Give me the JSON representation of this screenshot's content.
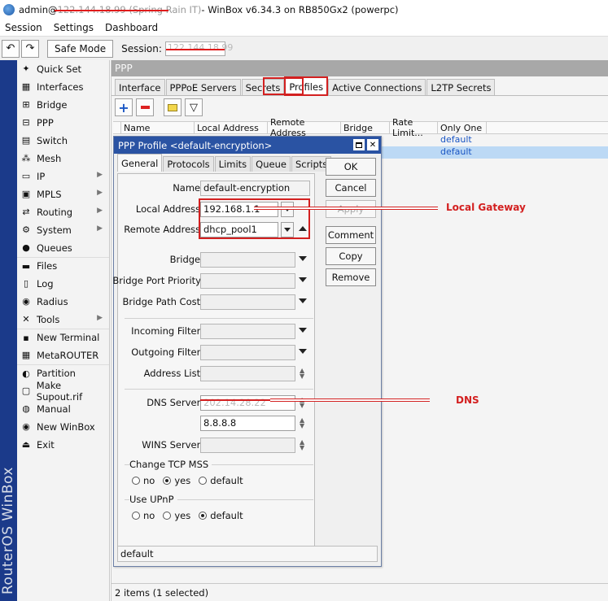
{
  "window": {
    "title": "admin@",
    "title_redacted": "122.144.18.99 (Spring Rain IT)",
    "title_rest": " - WinBox v6.34.3 on RB850Gx2 (powerpc)"
  },
  "menubar": [
    "Session",
    "Settings",
    "Dashboard"
  ],
  "toolbar": {
    "undo": "↶",
    "redo": "↷",
    "safe_mode": "Safe Mode",
    "session_label": "Session:",
    "session_value": "122.144.18.99"
  },
  "brand": "RouterOS WinBox",
  "sidebar": {
    "items": [
      {
        "label": "Quick Set",
        "icon": "quick-set-icon",
        "glyph": "✦",
        "submenu": false
      },
      {
        "label": "Interfaces",
        "icon": "interfaces-icon",
        "glyph": "▦",
        "submenu": false
      },
      {
        "label": "Bridge",
        "icon": "bridge-icon",
        "glyph": "⊞",
        "submenu": false
      },
      {
        "label": "PPP",
        "icon": "ppp-icon",
        "glyph": "⊟",
        "submenu": false
      },
      {
        "label": "Switch",
        "icon": "switch-icon",
        "glyph": "▤",
        "submenu": false
      },
      {
        "label": "Mesh",
        "icon": "mesh-icon",
        "glyph": "⁂",
        "submenu": false
      },
      {
        "label": "IP",
        "icon": "ip-icon",
        "glyph": "▭",
        "submenu": true
      },
      {
        "label": "MPLS",
        "icon": "mpls-icon",
        "glyph": "▣",
        "submenu": true
      },
      {
        "label": "Routing",
        "icon": "routing-icon",
        "glyph": "⇄",
        "submenu": true
      },
      {
        "label": "System",
        "icon": "system-icon",
        "glyph": "⚙",
        "submenu": true
      },
      {
        "label": "Queues",
        "icon": "queues-icon",
        "glyph": "●",
        "submenu": false
      },
      {
        "label": "Files",
        "icon": "files-icon",
        "glyph": "▬",
        "submenu": false
      },
      {
        "label": "Log",
        "icon": "log-icon",
        "glyph": "▯",
        "submenu": false
      },
      {
        "label": "Radius",
        "icon": "radius-icon",
        "glyph": "◉",
        "submenu": false
      },
      {
        "label": "Tools",
        "icon": "tools-icon",
        "glyph": "✕",
        "submenu": true
      },
      {
        "label": "New Terminal",
        "icon": "terminal-icon",
        "glyph": "▪",
        "submenu": false
      },
      {
        "label": "MetaROUTER",
        "icon": "metarouter-icon",
        "glyph": "▦",
        "submenu": false
      },
      {
        "label": "Partition",
        "icon": "partition-icon",
        "glyph": "◐",
        "submenu": false
      },
      {
        "label": "Make Supout.rif",
        "icon": "supout-icon",
        "glyph": "▢",
        "submenu": false
      },
      {
        "label": "Manual",
        "icon": "manual-icon",
        "glyph": "◍",
        "submenu": false
      },
      {
        "label": "New WinBox",
        "icon": "winbox-icon",
        "glyph": "◉",
        "submenu": false
      },
      {
        "label": "Exit",
        "icon": "exit-icon",
        "glyph": "⏏",
        "submenu": false
      }
    ]
  },
  "ppp": {
    "title": "PPP",
    "tabs": [
      "Interface",
      "PPPoE Servers",
      "Secrets",
      "Profiles",
      "Active Connections",
      "L2TP Secrets"
    ],
    "active_tab": "Profiles",
    "columns": [
      "Name",
      "Local Address",
      "Remote Address",
      "Bridge",
      "Rate Limit...",
      "Only One"
    ],
    "rows": [
      {
        "only_one": "default",
        "selected": false
      },
      {
        "only_one": "default",
        "selected": true
      }
    ],
    "status": "2 items (1 selected)"
  },
  "dialog": {
    "title": "PPP Profile <default-encryption>",
    "tabs": [
      "General",
      "Protocols",
      "Limits",
      "Queue",
      "Scripts"
    ],
    "fields": {
      "name_label": "Name:",
      "name_value": "default-encryption",
      "local_label": "Local Address:",
      "local_value": "192.168.1.1",
      "remote_label": "Remote Address:",
      "remote_value": "dhcp_pool1",
      "bridge_label": "Bridge:",
      "bpp_label": "Bridge Port Priority:",
      "bpc_label": "Bridge Path Cost:",
      "in_filter_label": "Incoming Filter:",
      "out_filter_label": "Outgoing Filter:",
      "addr_list_label": "Address List:",
      "dns_label": "DNS Server:",
      "dns1_value": "202.14.28.22",
      "dns2_value": "8.8.8.8",
      "wins_label": "WINS Server:"
    },
    "tcp_mss": {
      "label": "Change TCP MSS",
      "options": [
        "no",
        "yes",
        "default"
      ],
      "selected": "yes"
    },
    "upnp": {
      "label": "Use UPnP",
      "options": [
        "no",
        "yes",
        "default"
      ],
      "selected": "default"
    },
    "buttons": [
      "OK",
      "Cancel",
      "Apply",
      "Comment",
      "Copy",
      "Remove"
    ],
    "status": "default"
  },
  "annotations": {
    "local_gateway": "Local Gateway",
    "dns": "DNS"
  },
  "colors": {
    "brand_strip": "#1b3a8a",
    "dialog_title": "#2a53a3",
    "annotation": "#d32020",
    "selection": "#bcd9f5"
  }
}
